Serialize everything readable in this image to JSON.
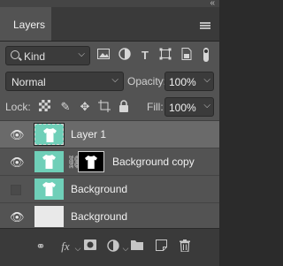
{
  "window": {
    "collapse_glyph": "«"
  },
  "tabs": [
    {
      "label": "Layers",
      "active": true
    }
  ],
  "panel_menu_icon": "hamburger-icon",
  "filter": {
    "kind_label": "Kind",
    "icons": [
      "image-filter-icon",
      "adjustment-filter-icon",
      "type-filter-icon",
      "shape-filter-icon",
      "smart-object-filter-icon"
    ]
  },
  "blend": {
    "mode": "Normal",
    "opacity_label": "Opacity:",
    "opacity_value": "100%"
  },
  "lock": {
    "label": "Lock:",
    "icons": [
      "lock-transparent-icon",
      "lock-image-icon",
      "lock-position-icon",
      "lock-artboard-icon",
      "lock-all-icon"
    ],
    "fill_label": "Fill:",
    "fill_value": "100%"
  },
  "layers": [
    {
      "name": "Layer 1",
      "visible": true,
      "selected": true,
      "thumb": "teal-shirt",
      "mask": false
    },
    {
      "name": "Background copy",
      "visible": true,
      "selected": false,
      "thumb": "teal-shirt",
      "mask": true
    },
    {
      "name": "Background",
      "visible": false,
      "selected": false,
      "thumb": "teal-shirt",
      "mask": false
    },
    {
      "name": "Background",
      "visible": true,
      "selected": false,
      "thumb": "plain",
      "mask": false
    }
  ],
  "bottom_icons": [
    "link-layers-icon",
    "fx-icon",
    "add-mask-icon",
    "adjustment-layer-icon",
    "new-group-icon",
    "new-layer-icon",
    "delete-layer-icon"
  ],
  "colors": {
    "panel": "#535353",
    "selected_row": "#6a6a6a",
    "thumb_teal": "#6fcfb8"
  }
}
